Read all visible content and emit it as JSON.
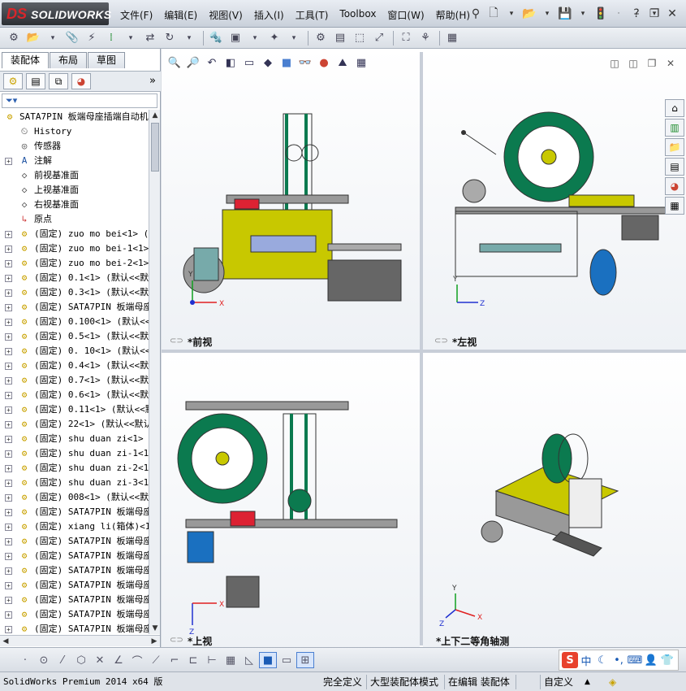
{
  "app": {
    "logo_ds": "DS",
    "logo_name": "SOLIDWORKS"
  },
  "menus": [
    "文件(F)",
    "编辑(E)",
    "视图(V)",
    "插入(I)",
    "工具(T)",
    "Toolbox",
    "窗口(W)",
    "帮助(H)"
  ],
  "left_panel": {
    "tabs": [
      "装配体",
      "布局",
      "草图"
    ],
    "filter_icon": "filter-icon",
    "tree": [
      {
        "label": "SATA7PIN 板端母座插端自动机",
        "icon": "assembly-icon",
        "root": true
      },
      {
        "label": "History",
        "icon": "history-icon"
      },
      {
        "label": "传感器",
        "icon": "sensor-icon"
      },
      {
        "label": "注解",
        "icon": "annotation-icon",
        "expand": true
      },
      {
        "label": "前视基准面",
        "icon": "plane-icon"
      },
      {
        "label": "上视基准面",
        "icon": "plane-icon"
      },
      {
        "label": "右视基准面",
        "icon": "plane-icon"
      },
      {
        "label": "原点",
        "icon": "origin-icon"
      },
      {
        "label": "(固定) zuo mo bei<1> (默",
        "icon": "part-icon",
        "expand": true
      },
      {
        "label": "(固定) zuo mo bei-1<1>",
        "icon": "part-icon",
        "expand": true
      },
      {
        "label": "(固定) zuo mo bei-2<1>",
        "icon": "part-icon",
        "expand": true
      },
      {
        "label": "(固定) 0.1<1> (默认<<默",
        "icon": "part-icon",
        "expand": true
      },
      {
        "label": "(固定) 0.3<1> (默认<<默",
        "icon": "part-icon",
        "expand": true
      },
      {
        "label": "(固定) SATA7PIN 板端母座",
        "icon": "part-icon",
        "expand": true
      },
      {
        "label": "(固定) 0.100<1> (默认<<",
        "icon": "part-icon",
        "expand": true
      },
      {
        "label": "(固定) 0.5<1> (默认<<默",
        "icon": "part-icon",
        "expand": true
      },
      {
        "label": "(固定) 0. 10<1> (默认<<",
        "icon": "part-icon",
        "expand": true
      },
      {
        "label": "(固定) 0.4<1> (默认<<默",
        "icon": "part-icon",
        "expand": true
      },
      {
        "label": "(固定) 0.7<1> (默认<<默",
        "icon": "part-icon",
        "expand": true
      },
      {
        "label": "(固定) 0.6<1> (默认<<默",
        "icon": "part-icon",
        "expand": true
      },
      {
        "label": "(固定) 0.11<1> (默认<<默",
        "icon": "part-icon",
        "expand": true
      },
      {
        "label": "(固定) 22<1> (默认<<默认",
        "icon": "part-icon",
        "expand": true
      },
      {
        "label": "(固定) shu duan zi<1> (",
        "icon": "part-icon",
        "expand": true
      },
      {
        "label": "(固定) shu duan zi-1<1>",
        "icon": "part-icon",
        "expand": true
      },
      {
        "label": "(固定) shu duan zi-2<1>",
        "icon": "part-icon",
        "expand": true
      },
      {
        "label": "(固定) shu duan zi-3<1>",
        "icon": "part-icon",
        "expand": true
      },
      {
        "label": "(固定) 008<1> (默认<<默",
        "icon": "part-icon",
        "expand": true
      },
      {
        "label": "(固定) SATA7PIN 板端母座",
        "icon": "part-icon",
        "expand": true
      },
      {
        "label": "(固定) xiang li(箱体)<1",
        "icon": "part-icon",
        "expand": true
      },
      {
        "label": "(固定) SATA7PIN 板端母座",
        "icon": "part-icon",
        "expand": true
      },
      {
        "label": "(固定) SATA7PIN 板端母座",
        "icon": "part-icon",
        "expand": true
      },
      {
        "label": "(固定) SATA7PIN 板端母座",
        "icon": "part-icon",
        "expand": true
      },
      {
        "label": "(固定) SATA7PIN 板端母座",
        "icon": "part-icon",
        "expand": true
      },
      {
        "label": "(固定) SATA7PIN 板端母座",
        "icon": "part-icon",
        "expand": true
      },
      {
        "label": "(固定) SATA7PIN 板端母座",
        "icon": "part-icon",
        "expand": true
      },
      {
        "label": "(固定) SATA7PIN 板端母座",
        "icon": "part-icon",
        "expand": true
      }
    ]
  },
  "viewports": {
    "front": "*前视",
    "left": "*左视",
    "top": "*上视",
    "iso": "*上下二等角轴测",
    "axis": {
      "x": "X",
      "y": "Y",
      "z": "Z"
    }
  },
  "ime": {
    "brand": "S",
    "lang": "中"
  },
  "status": {
    "product": "SolidWorks Premium 2014 x64 版",
    "state1": "完全定义",
    "state2": "大型装配体模式",
    "state3": "在编辑 装配体",
    "units": "自定义",
    "units_arrow": "▲"
  },
  "colors": {
    "accent": "#d9262b",
    "part_yellow": "#c9a200",
    "machine_green": "#0b7a4f",
    "axis_red": "#e02020",
    "axis_blue": "#2030d0",
    "axis_green": "#10a020"
  }
}
